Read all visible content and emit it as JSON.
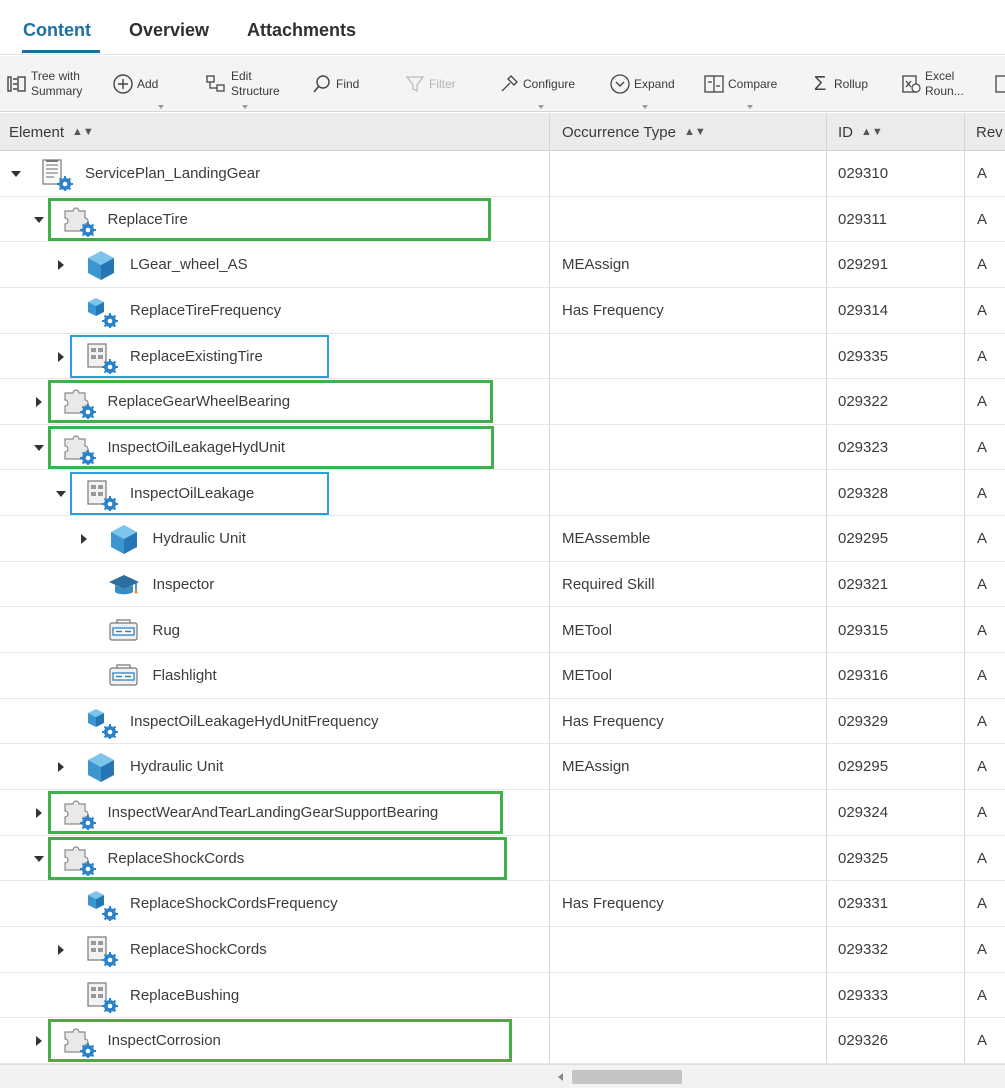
{
  "tabs": [
    {
      "label": "Content",
      "active": true
    },
    {
      "label": "Overview",
      "active": false
    },
    {
      "label": "Attachments",
      "active": false
    }
  ],
  "toolbar": {
    "tree_with_summary_l1": "Tree with",
    "tree_with_summary_l2": "Summary",
    "add": "Add",
    "edit_structure_l1": "Edit",
    "edit_structure_l2": "Structure",
    "find": "Find",
    "filter": "Filter",
    "configure": "Configure",
    "expand": "Expand",
    "compare": "Compare",
    "rollup": "Rollup",
    "excel_l1": "Excel",
    "excel_l2": "Roun..."
  },
  "columns": {
    "element": "Element",
    "occurrence_type": "Occurrence Type",
    "id": "ID",
    "rev": "Rev"
  },
  "rows": [
    {
      "name": "ServicePlan_LandingGear",
      "occurrence": "",
      "id": "029310",
      "rev": "A"
    },
    {
      "name": "ReplaceTire",
      "occurrence": "",
      "id": "029311",
      "rev": "A"
    },
    {
      "name": "LGear_wheel_AS",
      "occurrence": "MEAssign",
      "id": "029291",
      "rev": "A"
    },
    {
      "name": "ReplaceTireFrequency",
      "occurrence": "Has Frequency",
      "id": "029314",
      "rev": "A"
    },
    {
      "name": "ReplaceExistingTire",
      "occurrence": "",
      "id": "029335",
      "rev": "A"
    },
    {
      "name": "ReplaceGearWheelBearing",
      "occurrence": "",
      "id": "029322",
      "rev": "A"
    },
    {
      "name": "InspectOilLeakageHydUnit",
      "occurrence": "",
      "id": "029323",
      "rev": "A"
    },
    {
      "name": "InspectOilLeakage",
      "occurrence": "",
      "id": "029328",
      "rev": "A"
    },
    {
      "name": "Hydraulic Unit",
      "occurrence": "MEAssemble",
      "id": "029295",
      "rev": "A"
    },
    {
      "name": "Inspector",
      "occurrence": "Required Skill",
      "id": "029321",
      "rev": "A"
    },
    {
      "name": "Rug",
      "occurrence": "METool",
      "id": "029315",
      "rev": "A"
    },
    {
      "name": "Flashlight",
      "occurrence": "METool",
      "id": "029316",
      "rev": "A"
    },
    {
      "name": "InspectOilLeakageHydUnitFrequency",
      "occurrence": "Has Frequency",
      "id": "029329",
      "rev": "A"
    },
    {
      "name": "Hydraulic Unit",
      "occurrence": "MEAssign",
      "id": "029295",
      "rev": "A"
    },
    {
      "name": "InspectWearAndTearLandingGearSupportBearing",
      "occurrence": "",
      "id": "029324",
      "rev": "A"
    },
    {
      "name": "ReplaceShockCords",
      "occurrence": "",
      "id": "029325",
      "rev": "A"
    },
    {
      "name": "ReplaceShockCordsFrequency",
      "occurrence": "Has Frequency",
      "id": "029331",
      "rev": "A"
    },
    {
      "name": "ReplaceShockCords",
      "occurrence": "",
      "id": "029332",
      "rev": "A"
    },
    {
      "name": "ReplaceBushing",
      "occurrence": "",
      "id": "029333",
      "rev": "A"
    },
    {
      "name": "InspectCorrosion",
      "occurrence": "",
      "id": "029326",
      "rev": "A"
    }
  ],
  "colors": {
    "accent": "#1d6fa5",
    "highlight_green": "#3db24b",
    "highlight_blue": "#2a9fd8"
  }
}
